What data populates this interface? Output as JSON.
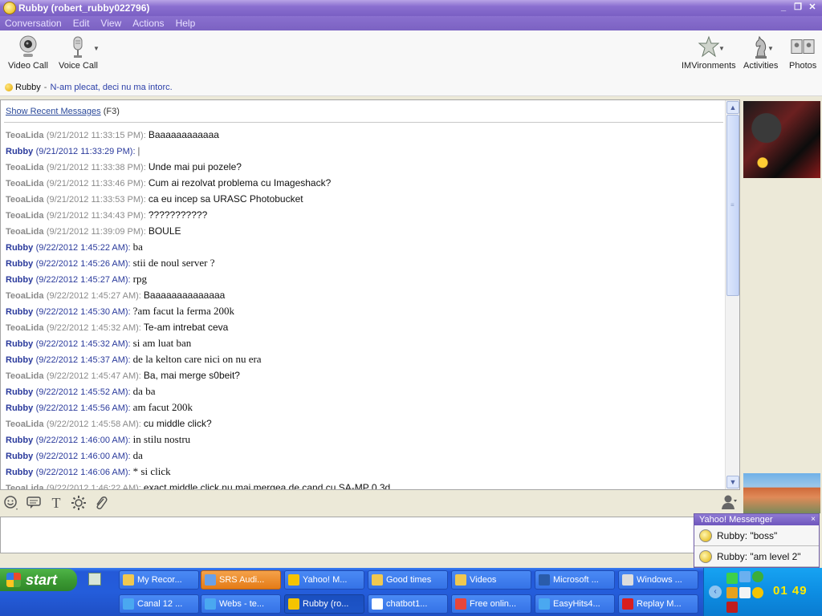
{
  "window": {
    "title": "Rubby (robert_rubby022796)",
    "controls": [
      "_",
      "❐",
      "✕"
    ]
  },
  "menu": [
    "Conversation",
    "Edit",
    "View",
    "Actions",
    "Help"
  ],
  "toolbar": {
    "left": [
      {
        "label": "Video Call",
        "icon": "webcam-icon"
      },
      {
        "label": "Voice Call",
        "icon": "microphone-icon"
      }
    ],
    "right": [
      {
        "label": "IMVironments",
        "icon": "imvironments-icon"
      },
      {
        "label": "Activities",
        "icon": "chess-knight-icon"
      },
      {
        "label": "Photos",
        "icon": "photos-icon"
      }
    ]
  },
  "contact": {
    "name": "Rubby",
    "separator": "-",
    "status_message": "N-am plecat, deci nu ma intorc."
  },
  "history": {
    "link": "Show Recent Messages",
    "shortcut": "(F3)"
  },
  "messages": [
    {
      "who": "TeoaLida",
      "ts": "(9/21/2012 11:33:15 PM)",
      "text": "Baaaaaaaaaaaa",
      "me": false
    },
    {
      "who": "Rubby",
      "ts": "(9/21/2012 11:33:29 PM)",
      "text": "|",
      "me": true
    },
    {
      "who": "TeoaLida",
      "ts": "(9/21/2012 11:33:38 PM)",
      "text": "Unde mai pui pozele?",
      "me": false
    },
    {
      "who": "TeoaLida",
      "ts": "(9/21/2012 11:33:46 PM)",
      "text": "Cum ai rezolvat problema cu  Imageshack?",
      "me": false
    },
    {
      "who": "TeoaLida",
      "ts": "(9/21/2012 11:33:53 PM)",
      "text": "ca eu incep sa URASC Photobucket",
      "me": false
    },
    {
      "who": "TeoaLida",
      "ts": "(9/21/2012 11:34:43 PM)",
      "text": "???????????",
      "me": false
    },
    {
      "who": "TeoaLida",
      "ts": "(9/21/2012 11:39:09 PM)",
      "text": "BOULE",
      "me": false
    },
    {
      "who": "Rubby",
      "ts": "(9/22/2012 1:45:22 AM)",
      "text": "ba",
      "me": true
    },
    {
      "who": "Rubby",
      "ts": "(9/22/2012 1:45:26 AM)",
      "text": "stii de noul server ?",
      "me": true
    },
    {
      "who": "Rubby",
      "ts": "(9/22/2012 1:45:27 AM)",
      "text": "rpg",
      "me": true
    },
    {
      "who": "TeoaLida",
      "ts": "(9/22/2012 1:45:27 AM)",
      "text": "Baaaaaaaaaaaaaa",
      "me": false
    },
    {
      "who": "Rubby",
      "ts": "(9/22/2012 1:45:30 AM)",
      "text": "?am facut la ferma 200k",
      "me": true
    },
    {
      "who": "TeoaLida",
      "ts": "(9/22/2012 1:45:32 AM)",
      "text": "Te-am intrebat ceva",
      "me": false
    },
    {
      "who": "Rubby",
      "ts": "(9/22/2012 1:45:32 AM)",
      "text": "si am luat ban",
      "me": true
    },
    {
      "who": "Rubby",
      "ts": "(9/22/2012 1:45:37 AM)",
      "text": "de la kelton care nici on nu era",
      "me": true
    },
    {
      "who": "TeoaLida",
      "ts": "(9/22/2012 1:45:47 AM)",
      "text": "Ba, mai merge s0beit?",
      "me": false
    },
    {
      "who": "Rubby",
      "ts": "(9/22/2012 1:45:52 AM)",
      "text": "da ba",
      "me": true
    },
    {
      "who": "Rubby",
      "ts": "(9/22/2012 1:45:56 AM)",
      "text": "am facut 200k",
      "me": true
    },
    {
      "who": "TeoaLida",
      "ts": "(9/22/2012 1:45:58 AM)",
      "text": "cu middle click?",
      "me": false
    },
    {
      "who": "Rubby",
      "ts": "(9/22/2012 1:46:00 AM)",
      "text": "in stilu nostru",
      "me": true
    },
    {
      "who": "Rubby",
      "ts": "(9/22/2012 1:46:00 AM)",
      "text": "da",
      "me": true
    },
    {
      "who": "Rubby",
      "ts": "(9/22/2012 1:46:06 AM)",
      "text": "* si click",
      "me": true
    },
    {
      "who": "TeoaLida",
      "ts": "(9/22/2012 1:46:22 AM)",
      "text": "exact middle click nu mai mergea de cand cu SA-MP 0.3d",
      "me": false
    }
  ],
  "notification": {
    "title": "Yahoo! Messenger",
    "close": "×",
    "items": [
      {
        "text": "Rubby:  \"boss\""
      },
      {
        "text": "Rubby:  \"am level 2\""
      }
    ]
  },
  "taskbar": {
    "start_label": "start",
    "row1": [
      {
        "label": "My Recor...",
        "icon": "folder-icon",
        "color": "#f0c850"
      },
      {
        "label": "SRS Audi...",
        "icon": "srs-audio-icon",
        "color": "#6aa0e8",
        "state": "orange"
      },
      {
        "label": "Yahoo! M...",
        "icon": "yahoo-messenger-icon",
        "color": "#f5c400"
      },
      {
        "label": "Good times",
        "icon": "folder-icon",
        "color": "#f0c850"
      },
      {
        "label": "Videos",
        "icon": "folder-icon",
        "color": "#f0c850"
      },
      {
        "label": "Microsoft ...",
        "icon": "word-icon",
        "color": "#2a5caa"
      },
      {
        "label": "Windows ...",
        "icon": "windows-app-icon",
        "color": "#dddddd"
      }
    ],
    "row2": [
      {
        "label": "Canal 12 ...",
        "icon": "ie-icon",
        "color": "#4aa8f0"
      },
      {
        "label": "Webs - te...",
        "icon": "ie-icon",
        "color": "#4aa8f0"
      },
      {
        "label": "Rubby (ro...",
        "icon": "yahoo-messenger-icon",
        "color": "#f5c400",
        "state": "active"
      },
      {
        "label": "chatbot1...",
        "icon": "chat-bubble-icon",
        "color": "#ffffff"
      },
      {
        "label": "Free onlin...",
        "icon": "chrome-icon",
        "color": "#e8463a"
      },
      {
        "label": "EasyHits4...",
        "icon": "ie-icon",
        "color": "#4aa8f0"
      },
      {
        "label": "Replay M...",
        "icon": "download-icon",
        "color": "#d81e1e"
      }
    ],
    "clock": "01 49"
  }
}
